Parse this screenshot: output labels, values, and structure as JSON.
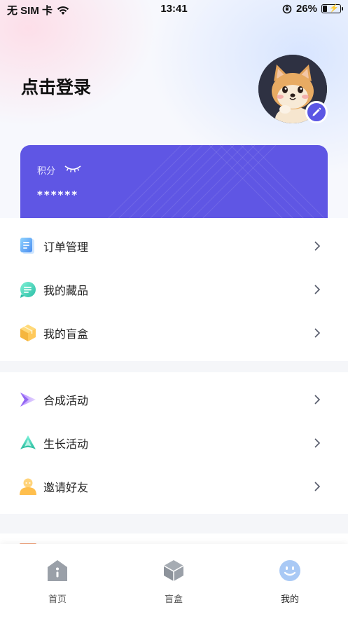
{
  "status_bar": {
    "carrier": "无 SIM 卡",
    "time": "13:41",
    "battery": "26%",
    "battery_level": 0.26
  },
  "header": {
    "login_text": "点击登录",
    "avatar_icon": "shiba-dog-avatar",
    "edit_icon": "pencil-icon",
    "accent_color": "#5b56e4"
  },
  "points_card": {
    "label": "积分",
    "value": "******",
    "eye_icon": "eye-closed-icon",
    "color": "#5f56e4"
  },
  "menu_groups": [
    {
      "items": [
        {
          "label": "订单管理",
          "icon": "order-doc-icon"
        },
        {
          "label": "我的藏品",
          "icon": "collection-chat-icon"
        },
        {
          "label": "我的盲盒",
          "icon": "blind-box-cube-icon"
        }
      ]
    },
    {
      "items": [
        {
          "label": "合成活动",
          "icon": "synthesis-arrow-icon"
        },
        {
          "label": "生长活动",
          "icon": "growth-leaf-icon"
        },
        {
          "label": "邀请好友",
          "icon": "invite-friend-icon"
        }
      ]
    }
  ],
  "tabbar": {
    "tabs": [
      {
        "label": "首页",
        "icon": "home-icon",
        "active": false
      },
      {
        "label": "盲盒",
        "icon": "box-icon",
        "active": false
      },
      {
        "label": "我的",
        "icon": "smiley-face-icon",
        "active": true
      }
    ]
  }
}
